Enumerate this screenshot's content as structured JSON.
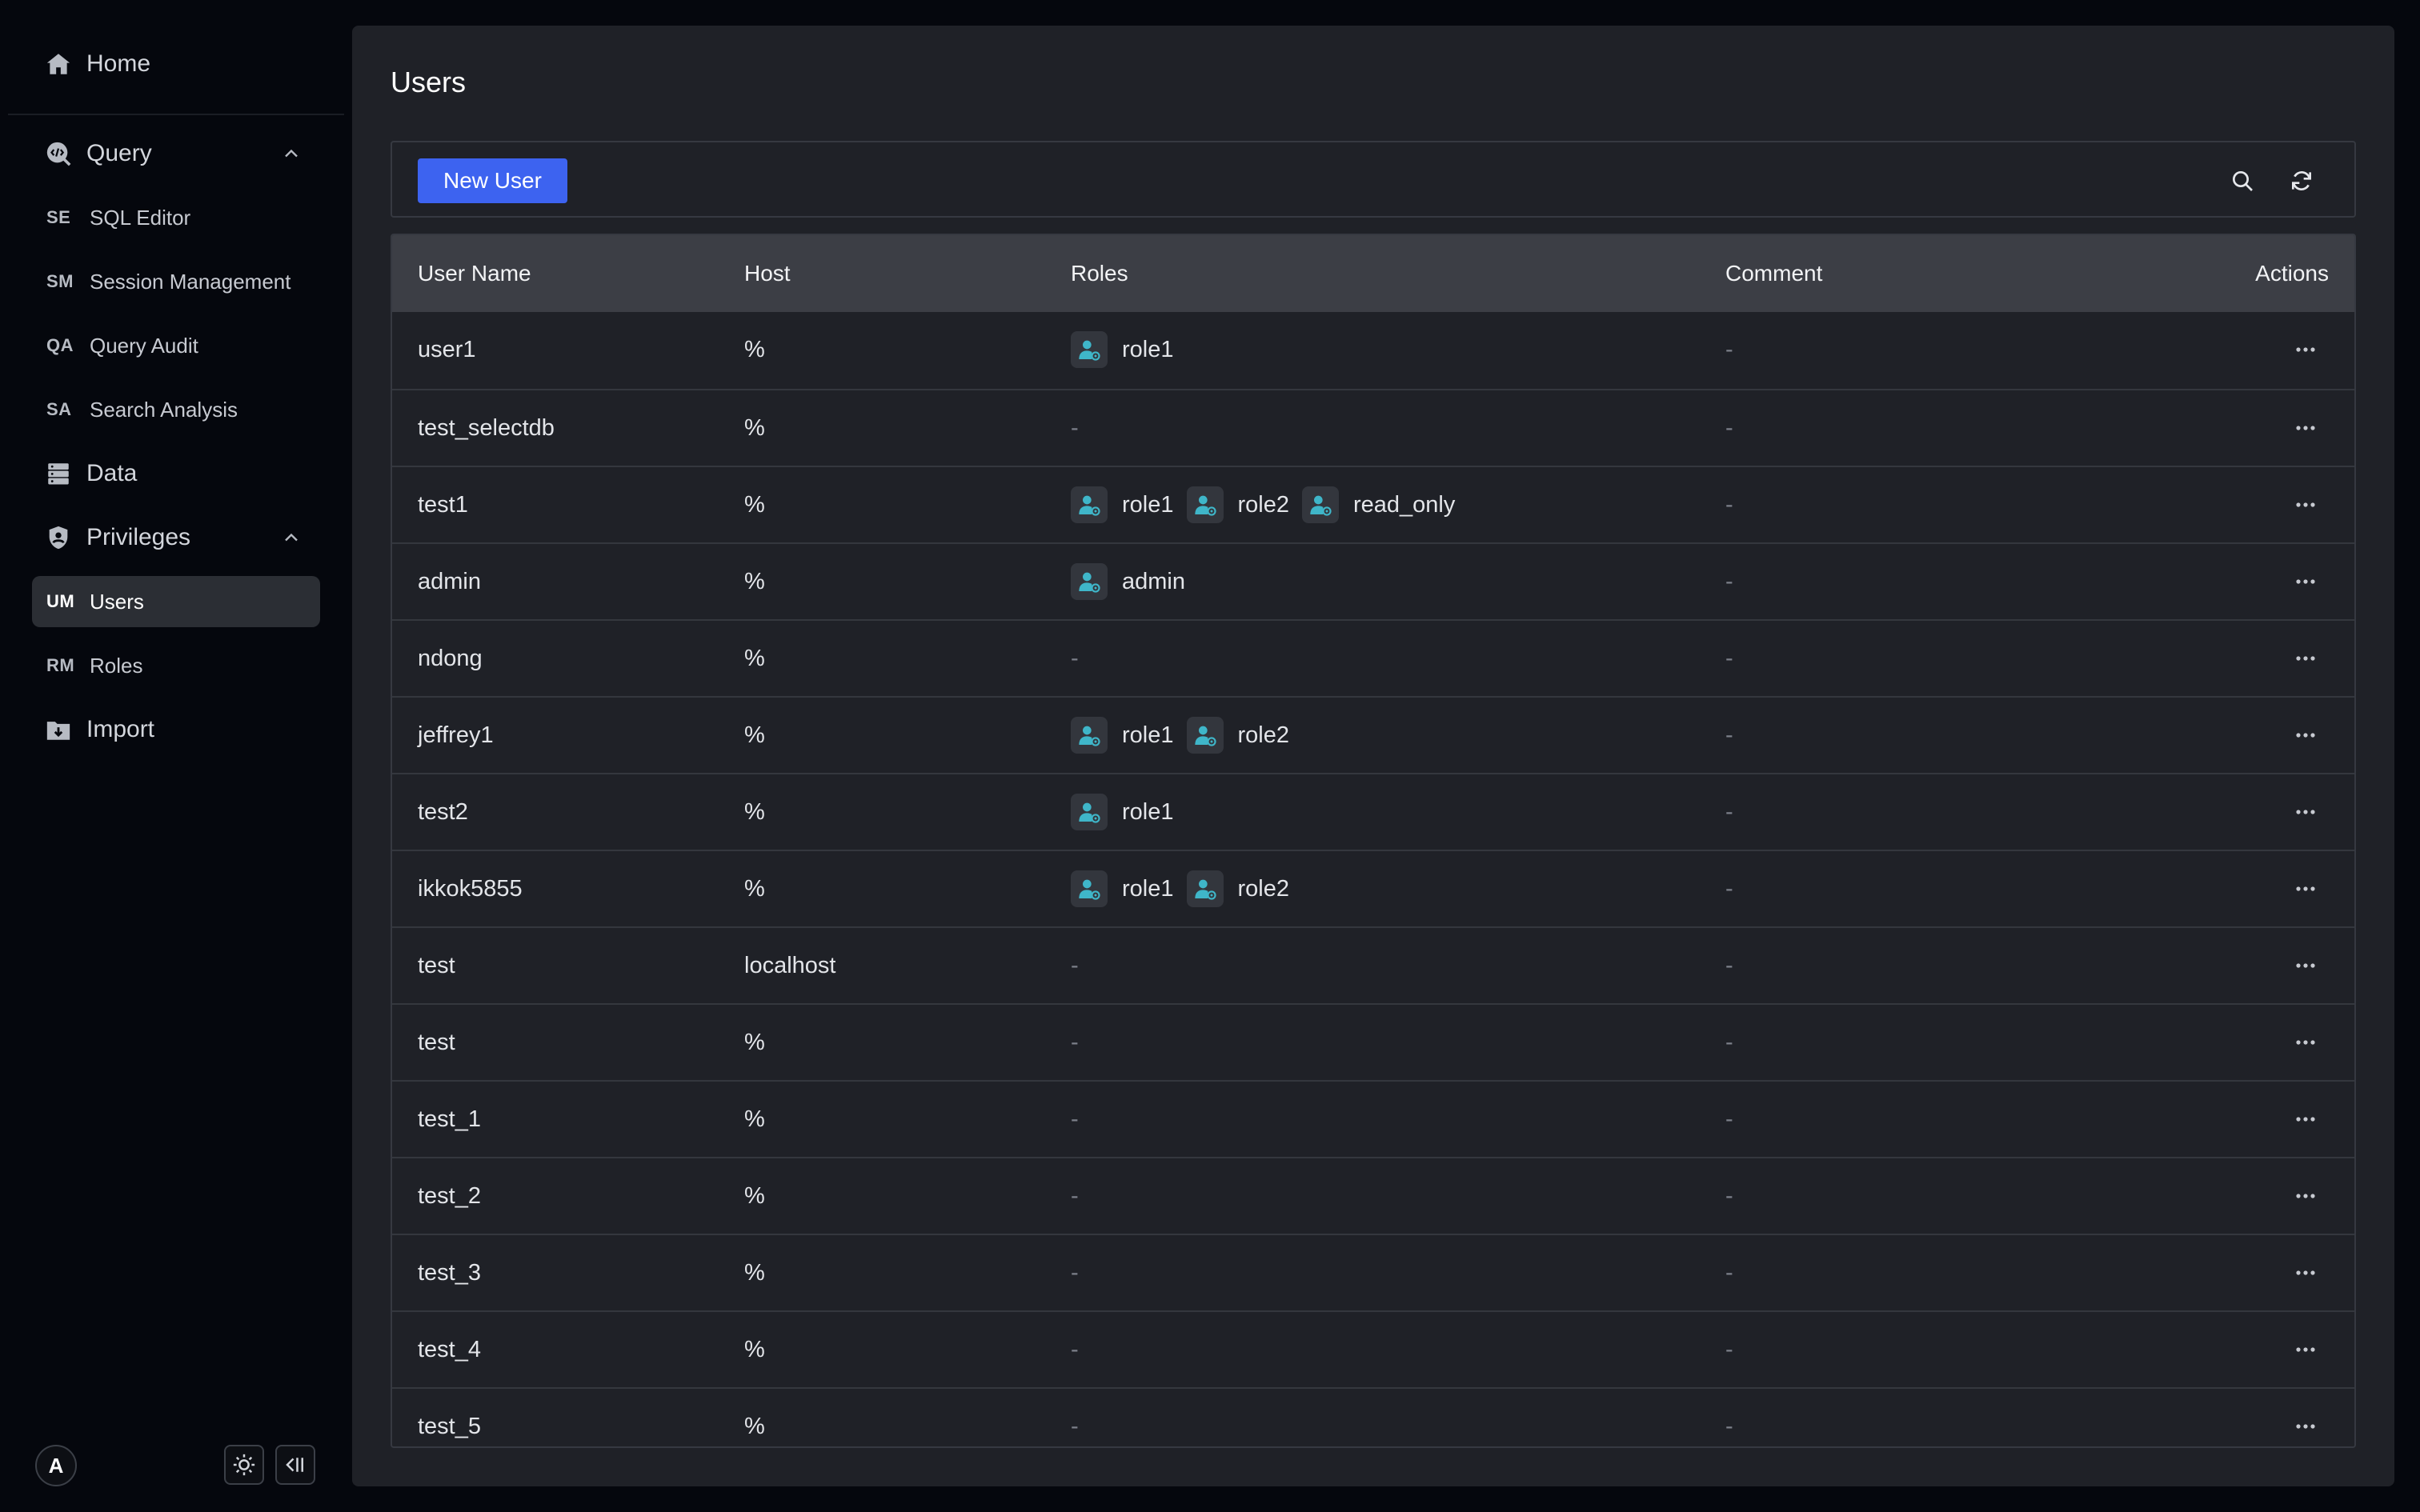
{
  "sidebar": {
    "home": {
      "label": "Home",
      "icon": "home-icon"
    },
    "query": {
      "label": "Query",
      "icon": "query-icon",
      "items": [
        {
          "abbr": "SE",
          "label": "SQL Editor"
        },
        {
          "abbr": "SM",
          "label": "Session Management"
        },
        {
          "abbr": "QA",
          "label": "Query Audit"
        },
        {
          "abbr": "SA",
          "label": "Search Analysis"
        }
      ]
    },
    "data": {
      "label": "Data",
      "icon": "database-icon"
    },
    "privileges": {
      "label": "Privileges",
      "icon": "shield-icon",
      "items": [
        {
          "abbr": "UM",
          "label": "Users",
          "active": true
        },
        {
          "abbr": "RM",
          "label": "Roles"
        }
      ]
    },
    "import": {
      "label": "Import",
      "icon": "import-icon"
    },
    "avatar_letter": "A"
  },
  "main": {
    "title": "Users",
    "toolbar": {
      "new_user_label": "New User"
    },
    "table": {
      "columns": [
        "User Name",
        "Host",
        "Roles",
        "Comment",
        "Actions"
      ],
      "rows": [
        {
          "name": "user1",
          "host": "%",
          "roles": [
            "role1"
          ],
          "comment": "-"
        },
        {
          "name": "test_selectdb",
          "host": "%",
          "roles": [],
          "comment": "-"
        },
        {
          "name": "test1",
          "host": "%",
          "roles": [
            "role1",
            "role2",
            "read_only"
          ],
          "comment": "-"
        },
        {
          "name": "admin",
          "host": "%",
          "roles": [
            "admin"
          ],
          "comment": "-"
        },
        {
          "name": "ndong",
          "host": "%",
          "roles": [],
          "comment": "-"
        },
        {
          "name": "jeffrey1",
          "host": "%",
          "roles": [
            "role1",
            "role2"
          ],
          "comment": "-"
        },
        {
          "name": "test2",
          "host": "%",
          "roles": [
            "role1"
          ],
          "comment": "-"
        },
        {
          "name": "ikkok5855",
          "host": "%",
          "roles": [
            "role1",
            "role2"
          ],
          "comment": "-"
        },
        {
          "name": "test",
          "host": "localhost",
          "roles": [],
          "comment": "-"
        },
        {
          "name": "test",
          "host": "%",
          "roles": [],
          "comment": "-"
        },
        {
          "name": "test_1",
          "host": "%",
          "roles": [],
          "comment": "-"
        },
        {
          "name": "test_2",
          "host": "%",
          "roles": [],
          "comment": "-"
        },
        {
          "name": "test_3",
          "host": "%",
          "roles": [],
          "comment": "-"
        },
        {
          "name": "test_4",
          "host": "%",
          "roles": [],
          "comment": "-"
        },
        {
          "name": "test_5",
          "host": "%",
          "roles": [],
          "comment": "-"
        }
      ],
      "empty_placeholder": "-"
    }
  },
  "colors": {
    "primary": "#3d63f0",
    "role_icon": "#3fb6c9",
    "background": "#05070d",
    "panel": "#1f2127"
  }
}
